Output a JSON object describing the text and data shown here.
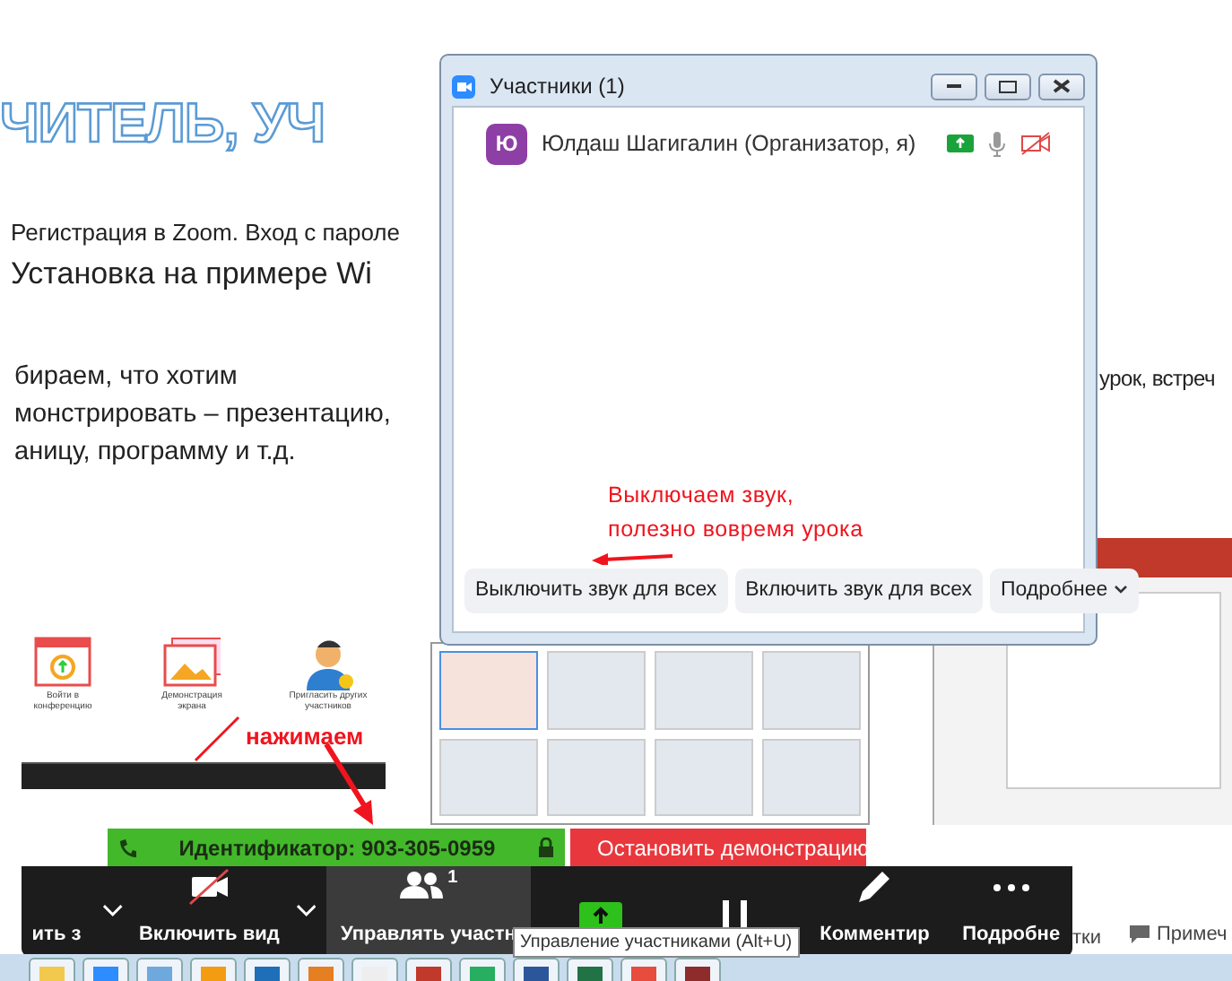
{
  "slide": {
    "title": "ЧИТЕЛЬ, УЧ",
    "line": "Регистрация в Zoom. Вход с пароле",
    "subtitle": "Установка на примере Wi",
    "body": [
      "бираем, что хотим",
      "монстрировать – презентацию,",
      "аницу, программу и т.д."
    ],
    "right_text": "урок, встреч"
  },
  "home_actions": [
    {
      "kind": "join",
      "label": "Войти в конференцию"
    },
    {
      "kind": "share",
      "label": "Демонстрация экрана"
    },
    {
      "kind": "invite",
      "label": "Пригласить других участников"
    }
  ],
  "click_note": "нажимаем",
  "participants_window": {
    "title": "Участники (1)",
    "participants": [
      {
        "initial": "Ю",
        "name": "Юлдаш Шагигалин (Организатор, я)",
        "sharing": true,
        "video_off": true
      }
    ],
    "note": [
      "Выключаем звук,",
      "полезно вовремя урока"
    ],
    "buttons": [
      "Выключить звук для всех",
      "Включить звук для всех",
      "Подробнее"
    ]
  },
  "share_bar": {
    "meeting_id": "Идентификатор: 903-305-0959",
    "stop": "Остановить демонстрацию"
  },
  "toolbar": {
    "items": [
      {
        "kind": "audio",
        "label": "ить з",
        "caret": true,
        "selected": false
      },
      {
        "kind": "video",
        "label": "Включить вид",
        "caret": true,
        "selected": false
      },
      {
        "kind": "participants",
        "label": "Управлять участн",
        "count": "1",
        "caret": false,
        "selected": true
      },
      {
        "kind": "share",
        "caret": false,
        "selected": false
      },
      {
        "kind": "pause",
        "caret": false,
        "selected": false
      },
      {
        "kind": "annotate",
        "label": "Комментир",
        "caret": false,
        "selected": false
      },
      {
        "kind": "more",
        "label": "Подробне",
        "caret": false,
        "selected": false
      }
    ]
  },
  "tooltip": "Управление участниками (Alt+U)",
  "status_texts": [
    "тки",
    "Примеч"
  ]
}
